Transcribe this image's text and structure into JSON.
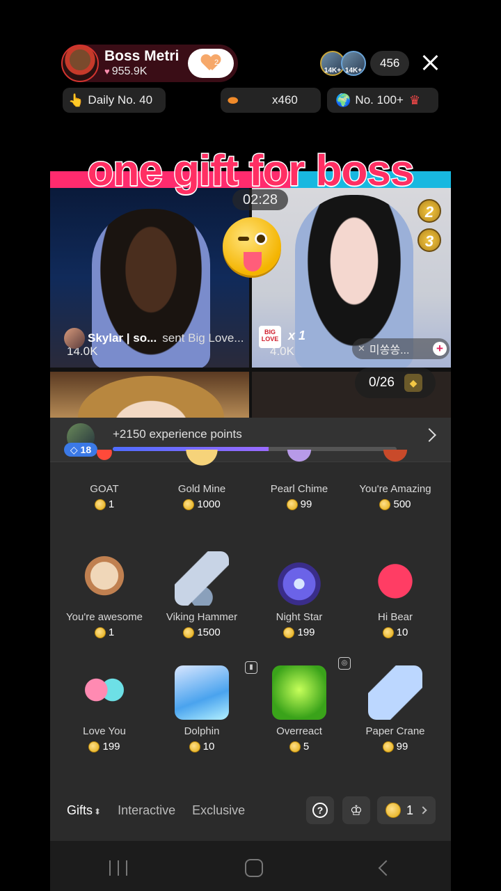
{
  "header": {
    "host_name": "Boss Metri",
    "host_likes": "955.9K",
    "follow_count": "2",
    "viewer_badges": [
      "14K+",
      "14K+"
    ],
    "viewer_count": "456"
  },
  "chips": {
    "daily": "Daily No. 40",
    "coins": "x460",
    "rank": "No. 100+"
  },
  "stream": {
    "overlay_title": "one gift for boss",
    "timer": "02:28",
    "rank_badges": [
      "2",
      "3"
    ],
    "left_score": "14.0K",
    "right_score": "4.0K",
    "gift_sender": "Skylar | so...",
    "gift_message": "sent Big Love...",
    "gift_icon_text": "BIG LOVE",
    "gift_multiplier": "x 1",
    "right_name": "미쏭쏭...",
    "goal_progress": "0/26"
  },
  "xp": {
    "text": "+2150 experience points",
    "level": "18",
    "progress": 0.55
  },
  "gifts": [
    {
      "name": "GOAT",
      "price": "1",
      "icon": "goat-gift-icon"
    },
    {
      "name": "Gold Mine",
      "price": "1000",
      "icon": "gold-mine-icon"
    },
    {
      "name": "Pearl Chime",
      "price": "99",
      "icon": "pearl-chime-icon"
    },
    {
      "name": "You're Amazing",
      "price": "500",
      "icon": "amazing-icon"
    },
    {
      "name": "You're awesome",
      "price": "1",
      "icon": "cat-icon"
    },
    {
      "name": "Viking Hammer",
      "price": "1500",
      "icon": "hammer-icon"
    },
    {
      "name": "Night Star",
      "price": "199",
      "icon": "night-star-icon"
    },
    {
      "name": "Hi Bear",
      "price": "10",
      "icon": "bear-icon"
    },
    {
      "name": "Love You",
      "price": "199",
      "icon": "hearts-icon"
    },
    {
      "name": "Dolphin",
      "price": "10",
      "icon": "dolphin-icon"
    },
    {
      "name": "Overreact",
      "price": "5",
      "icon": "overreact-icon"
    },
    {
      "name": "Paper Crane",
      "price": "99",
      "icon": "paper-crane-icon"
    }
  ],
  "tabs": {
    "gifts": "Gifts",
    "interactive": "Interactive",
    "exclusive": "Exclusive"
  },
  "wallet": {
    "balance": "1"
  }
}
